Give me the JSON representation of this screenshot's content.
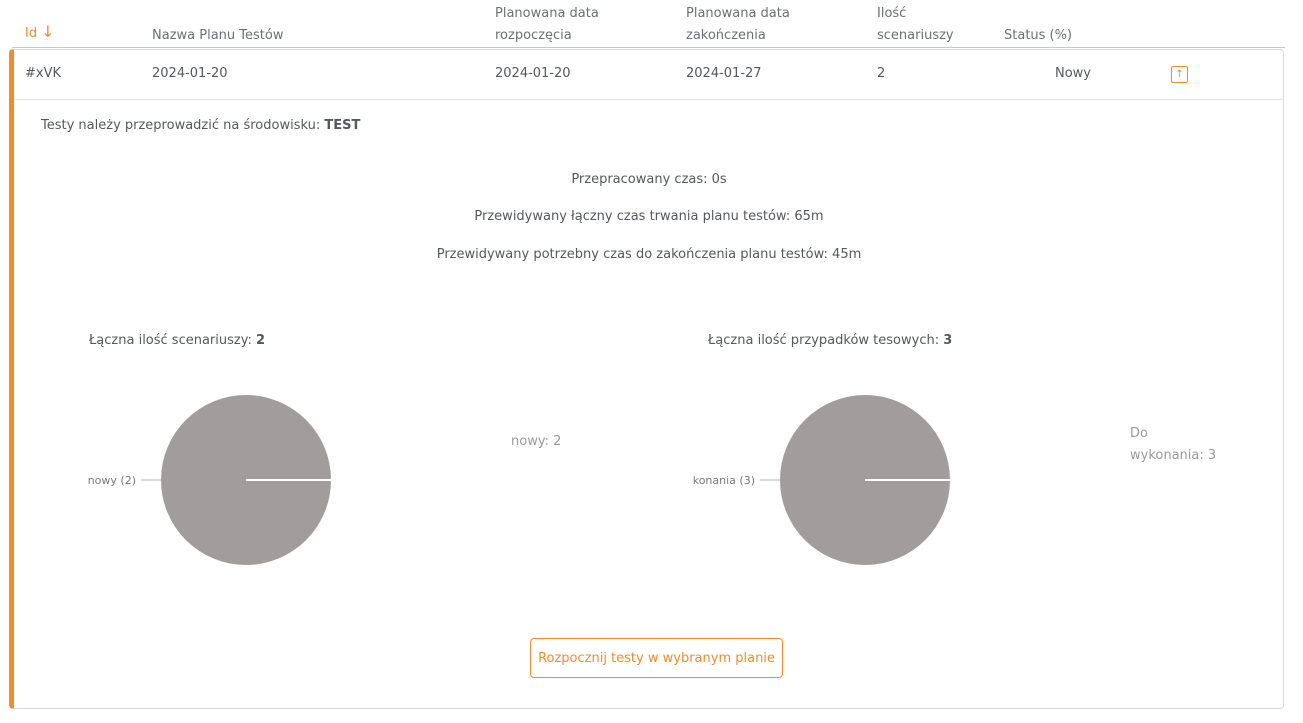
{
  "table": {
    "headers": {
      "id": "Id",
      "name": "Nazwa Planu Testów",
      "start_l1": "Planowana data",
      "start_l2": "rozpoczęcia",
      "end_l1": "Planowana data",
      "end_l2": "zakończenia",
      "count_l1": "Ilość",
      "count_l2": "scenariuszy",
      "status": "Status (%)"
    },
    "row": {
      "id": "#xVK",
      "name": "2024-01-20",
      "start": "2024-01-20",
      "end": "2024-01-27",
      "count": "2",
      "status": "Nowy"
    }
  },
  "details": {
    "env_prefix": "Testy należy przeprowadzić na środowisku: ",
    "env_value": "TEST",
    "elapsed": "Przepracowany czas: 0s",
    "estimated_total": "Przewidywany łączny czas trwania planu testów: 65m",
    "estimated_remaining": "Przewidywany potrzebny czas do zakończenia planu testów: 45m"
  },
  "chart_data": [
    {
      "type": "pie",
      "title_prefix": "Łączna ilość scenariuszy: ",
      "title_value": "2",
      "slices": [
        {
          "label": "nowy (2)",
          "value": 2
        }
      ],
      "legend": [
        "nowy: 2"
      ],
      "color": "#a09d9c"
    },
    {
      "type": "pie",
      "title_prefix": "Łączna ilość przypadków tesowych: ",
      "title_value": "3",
      "slices": [
        {
          "label": "konania (3)",
          "value": 3
        }
      ],
      "legend": [
        "Do",
        "wykonania: 3"
      ],
      "color": "#a09d9c"
    }
  ],
  "actions": {
    "start_tests": "Rozpocznij testy w wybranym planie"
  },
  "colors": {
    "accent": "#f28c28",
    "pie": "#a09d9c"
  }
}
